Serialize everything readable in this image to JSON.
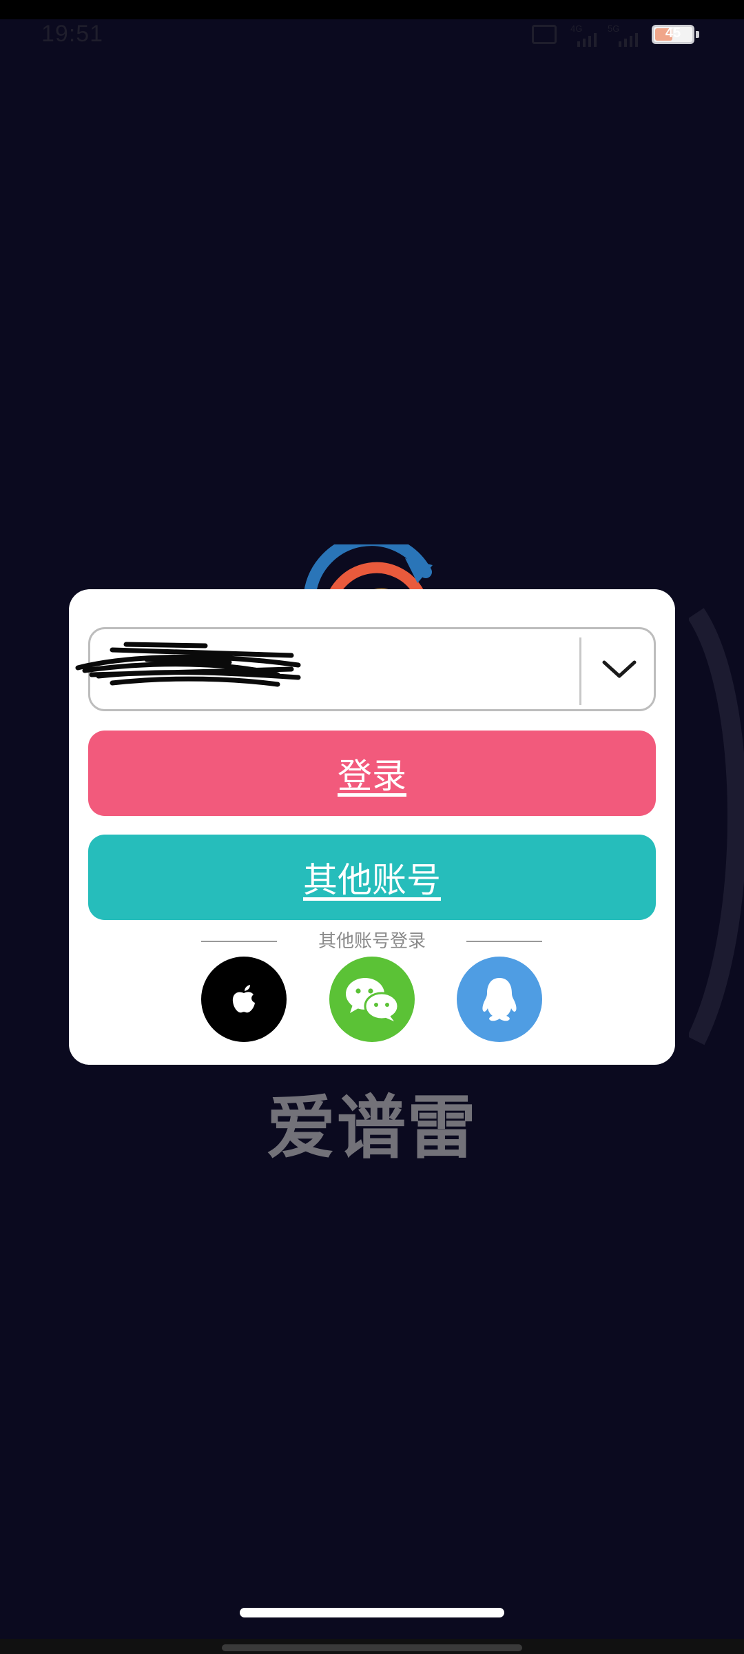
{
  "status_bar": {
    "time": "19:51",
    "signal_1_label": "4G",
    "signal_2_label": "5G",
    "battery": "45",
    "battery_level": 0.45
  },
  "background": {
    "brand_name": "爱谱雷"
  },
  "dialog": {
    "account_select": {
      "value": "",
      "icon": "chevron-down-icon"
    },
    "login_label": "登录",
    "other_account_label": "其他账号",
    "other_login_label": "其他账号登录",
    "social_logins": [
      {
        "name": "apple",
        "icon": "apple-icon",
        "color": "#000000"
      },
      {
        "name": "wechat",
        "icon": "wechat-icon",
        "color": "#5bc236"
      },
      {
        "name": "qq",
        "icon": "qq-penguin-icon",
        "color": "#4f9de3"
      }
    ]
  },
  "colors": {
    "background": "#0b0a1f",
    "login_button": "#f25a7c",
    "other_account_button": "#26bdbb"
  }
}
